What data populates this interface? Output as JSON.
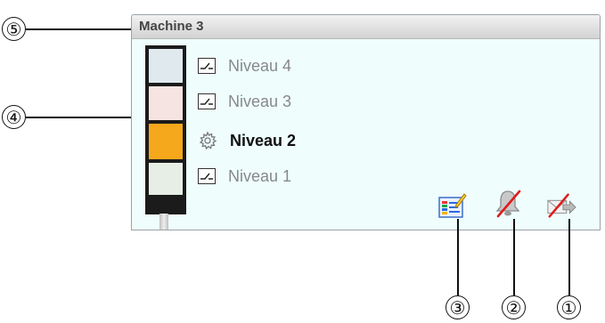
{
  "panel": {
    "title": "Machine 3"
  },
  "levels": [
    {
      "label": "Niveau 4",
      "icon": "switch-icon",
      "active": false
    },
    {
      "label": "Niveau 3",
      "icon": "switch-icon",
      "active": false
    },
    {
      "label": "Niveau 2",
      "icon": "gear-icon",
      "active": true
    },
    {
      "label": "Niveau 1",
      "icon": "switch-icon",
      "active": false
    }
  ],
  "tower_colors": {
    "level4": "#dfe9ee",
    "level3": "#f5e4e2",
    "level2": "#f5a81c",
    "level1": "#e6eee6",
    "base": "#1b1b1b"
  },
  "actions": [
    {
      "icon": "edit-chart-icon"
    },
    {
      "icon": "bell-disabled-icon"
    },
    {
      "icon": "forward-mail-disabled-icon"
    }
  ],
  "callouts": {
    "c1": "①",
    "c2": "②",
    "c3": "③",
    "c4": "④",
    "c5": "⑤"
  }
}
